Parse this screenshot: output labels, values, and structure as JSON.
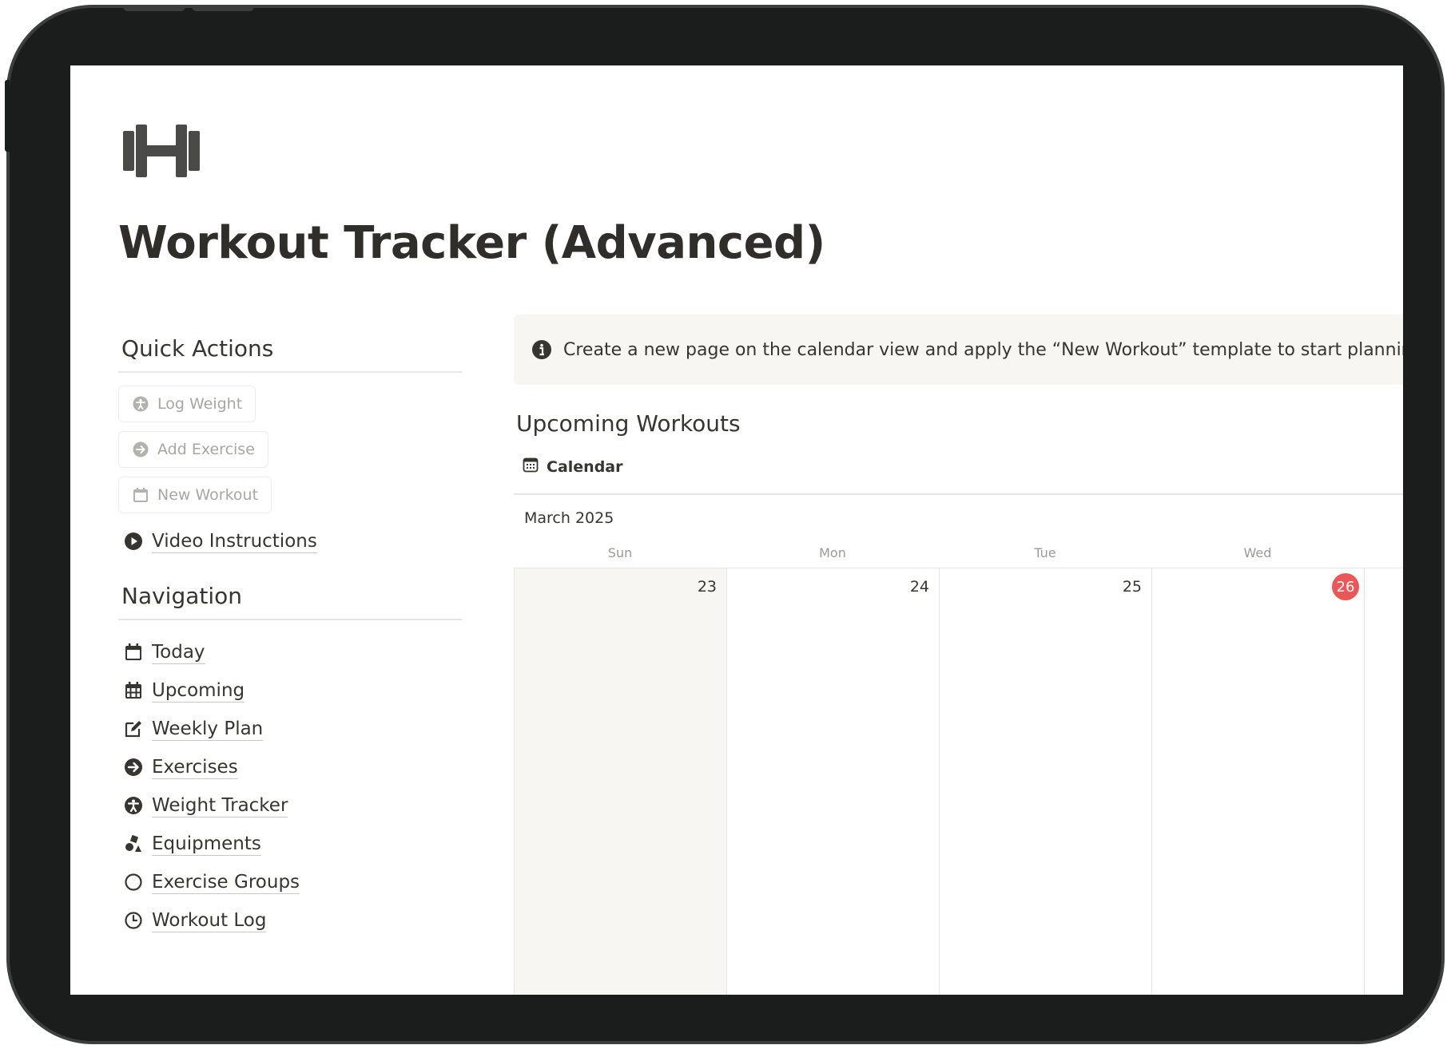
{
  "page": {
    "title": "Workout Tracker (Advanced)",
    "icon": "dumbbell-icon"
  },
  "quick_actions": {
    "heading": "Quick Actions",
    "buttons": [
      {
        "label": "Log Weight",
        "icon": "person-icon"
      },
      {
        "label": "Add Exercise",
        "icon": "arrow-circle-icon"
      },
      {
        "label": "New Workout",
        "icon": "calendar-icon"
      }
    ],
    "video_link": {
      "label": "Video Instructions",
      "icon": "play-circle-icon"
    }
  },
  "navigation": {
    "heading": "Navigation",
    "items": [
      {
        "label": "Today",
        "icon": "calendar-icon"
      },
      {
        "label": "Upcoming",
        "icon": "calendar-grid-icon"
      },
      {
        "label": "Weekly Plan",
        "icon": "edit-icon"
      },
      {
        "label": "Exercises",
        "icon": "arrow-circle-icon"
      },
      {
        "label": "Weight Tracker",
        "icon": "person-icon"
      },
      {
        "label": "Equipments",
        "icon": "shapes-icon"
      },
      {
        "label": "Exercise Groups",
        "icon": "circle-icon"
      },
      {
        "label": "Workout Log",
        "icon": "clock-icon"
      }
    ]
  },
  "callout": {
    "icon": "info-icon",
    "text": "Create a new page on the calendar view and apply the “New Workout” template to start planning your work"
  },
  "upcoming": {
    "heading": "Upcoming Workouts",
    "view_tab": "Calendar",
    "month": "March 2025",
    "days": [
      {
        "name": "Sun",
        "date": "23",
        "weekend": true,
        "today": false
      },
      {
        "name": "Mon",
        "date": "24",
        "weekend": false,
        "today": false
      },
      {
        "name": "Tue",
        "date": "25",
        "weekend": false,
        "today": false
      },
      {
        "name": "Wed",
        "date": "26",
        "weekend": false,
        "today": true
      }
    ]
  },
  "colors": {
    "today_badge": "#eb5757",
    "frame": "#1a1d1c",
    "callout_bg": "#f7f6f3"
  }
}
